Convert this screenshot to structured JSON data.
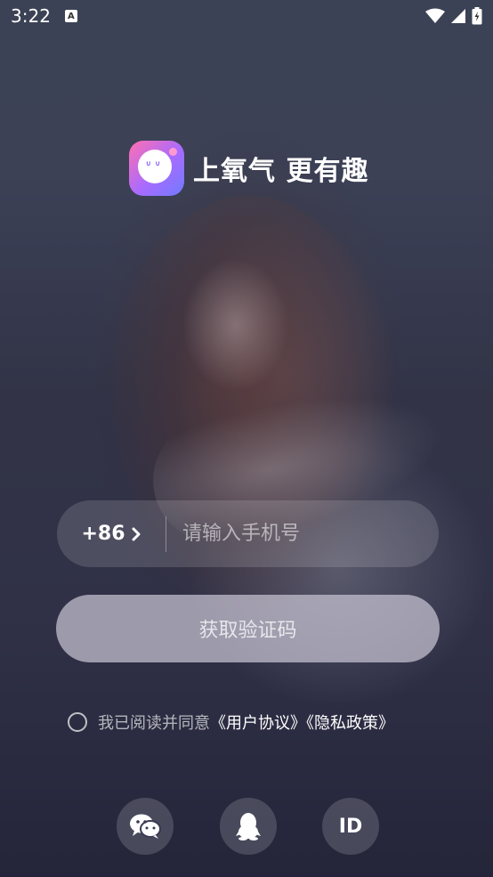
{
  "status_bar": {
    "time": "3:22",
    "notification_icon": "A"
  },
  "brand": {
    "slogan": "上氧气 更有趣"
  },
  "login": {
    "country_code": "+86",
    "phone_placeholder": "请输入手机号",
    "get_code_button": "获取验证码"
  },
  "agreement": {
    "prefix": "我已阅读并同意",
    "user_agreement": "《用户协议》",
    "privacy_policy": "《隐私政策》"
  },
  "social_login": {
    "options": [
      "wechat",
      "qq",
      "id"
    ],
    "id_label": "ID"
  }
}
